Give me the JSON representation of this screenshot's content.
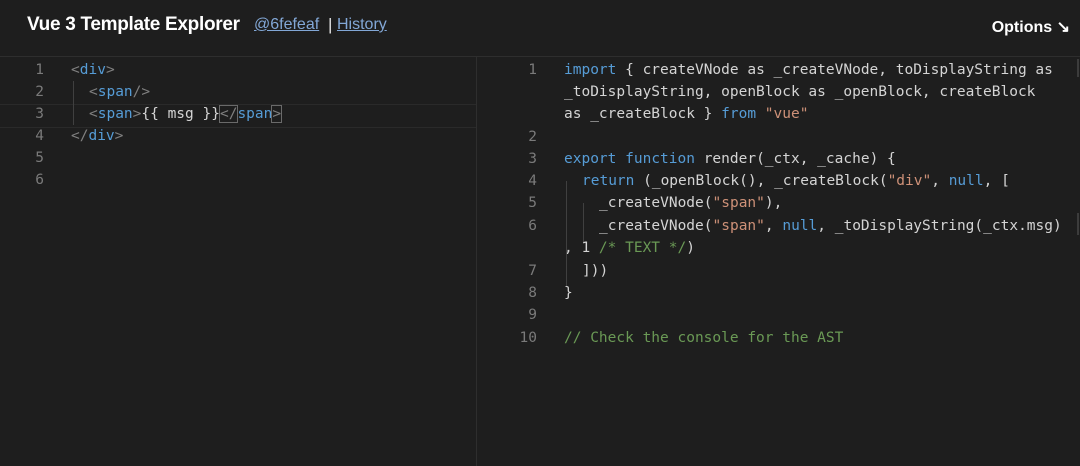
{
  "header": {
    "title": "Vue 3 Template Explorer",
    "commit": "@6fefeaf",
    "separator": "|",
    "history": "History",
    "options": "Options ↘"
  },
  "left": {
    "line_numbers": [
      "1",
      "2",
      "3",
      "4",
      "5",
      "6"
    ],
    "l1": {
      "open": "<",
      "tag": "div",
      "close": ">"
    },
    "l2": {
      "open": "<",
      "tag": "span",
      "close": "/>"
    },
    "l3": {
      "open": "<",
      "tag": "span",
      "close": ">",
      "text": "{{ msg }}",
      "open2": "</",
      "tag2": "span",
      "close2": ">"
    },
    "l4": {
      "open": "</",
      "tag": "div",
      "close": ">"
    }
  },
  "right": {
    "line_numbers": [
      "1",
      "2",
      "3",
      "4",
      "5",
      "6",
      "7",
      "8",
      "9",
      "10"
    ],
    "r1a": {
      "kw": "import",
      "rest": " { createVNode as _createVNode, toDisplayString as"
    },
    "r1b": "_toDisplayString, openBlock as _openBlock, createBlock",
    "r1c": {
      "pre": "as _createBlock } ",
      "kw": "from",
      "sp": " ",
      "str": "\"vue\""
    },
    "r3": {
      "kw1": "export",
      "sp1": " ",
      "kw2": "function",
      "rest": " render(_ctx, _cache) {"
    },
    "r4": {
      "kw": "return",
      "a": " (_openBlock(), _createBlock(",
      "s": "\"div\"",
      "b": ", ",
      "kw2": "null",
      "c": ", ["
    },
    "r5": {
      "a": "_createVNode(",
      "s": "\"span\"",
      "b": "),"
    },
    "r6": {
      "a": "_createVNode(",
      "s": "\"span\"",
      "b": ", ",
      "kw": "null",
      "c": ", _toDisplayString(_ctx.msg)"
    },
    "r6b": {
      "a": ", 1 ",
      "cm": "/* TEXT */",
      "b": ")"
    },
    "r7": "]))",
    "r8": "}",
    "r10": "// Check the console for the AST"
  }
}
